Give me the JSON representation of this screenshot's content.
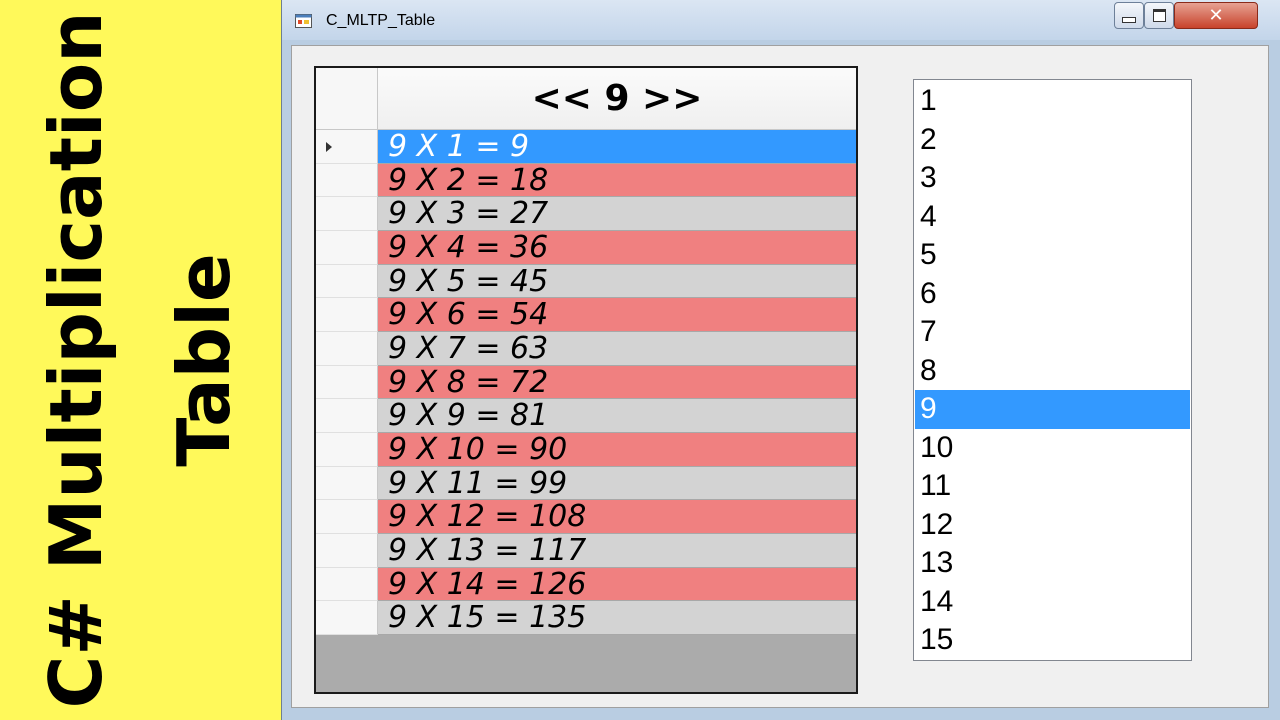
{
  "banner": {
    "line1": "C# Multiplication",
    "line2": "Table"
  },
  "window": {
    "title": "C_MLTP_Table",
    "icon": "winforms-app-icon",
    "controls": {
      "minimize": "minimize-icon",
      "maximize": "maximize-icon",
      "close": "✕"
    }
  },
  "grid": {
    "header": "<< 9 >>",
    "rows": [
      "9 X 1 = 9",
      "9 X 2 = 18",
      "9 X 3 = 27",
      "9 X 4 = 36",
      "9 X 5 = 45",
      "9 X 6 = 54",
      "9 X 7 = 63",
      "9 X 8 = 72",
      "9 X 9 = 81",
      "9 X 10 = 90",
      "9 X 11 = 99",
      "9 X 12 = 108",
      "9 X 13 = 117",
      "9 X 14 = 126",
      "9 X 15 = 135"
    ],
    "selected_row_index": 0,
    "colors": {
      "selected": "#3399ff",
      "even_row": "#f08080",
      "odd_row": "#d3d3d3"
    }
  },
  "listbox": {
    "items": [
      "1",
      "2",
      "3",
      "4",
      "5",
      "6",
      "7",
      "8",
      "9",
      "10",
      "11",
      "12",
      "13",
      "14",
      "15"
    ],
    "selected_index": 8,
    "selected_color": "#3399ff"
  }
}
